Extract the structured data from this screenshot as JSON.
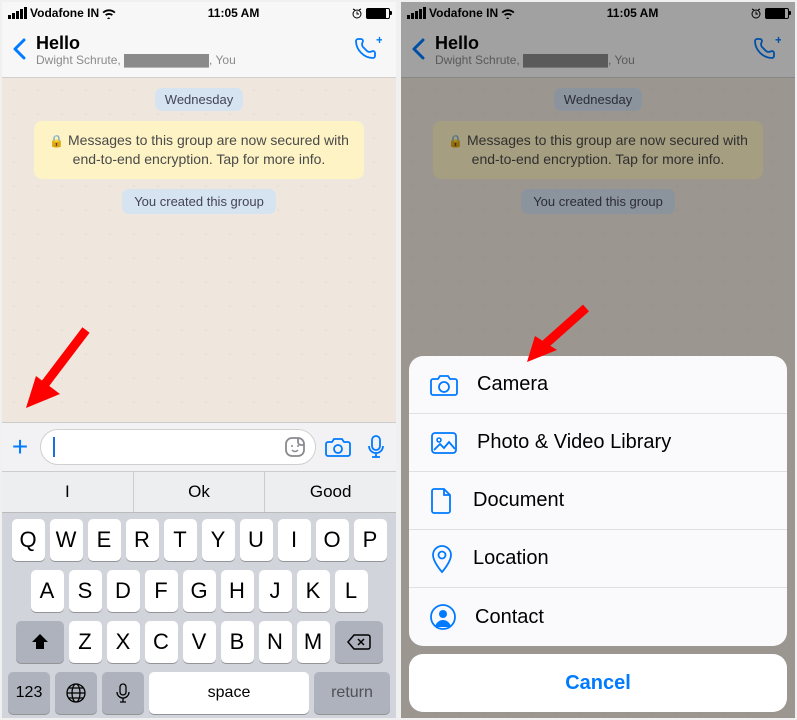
{
  "status": {
    "carrier": "Vodafone IN",
    "time": "11:05 AM"
  },
  "chat": {
    "title": "Hello",
    "subtitle": "Dwight Schrute, ██████████, You",
    "date_label": "Wednesday",
    "encryption_notice": "Messages to this group are now secured with end-to-end encryption. Tap for more info.",
    "system_message": "You created this group"
  },
  "suggestions": [
    "I",
    "Ok",
    "Good"
  ],
  "keyboard": {
    "row1": [
      "Q",
      "W",
      "E",
      "R",
      "T",
      "Y",
      "U",
      "I",
      "O",
      "P"
    ],
    "row2": [
      "A",
      "S",
      "D",
      "F",
      "G",
      "H",
      "J",
      "K",
      "L"
    ],
    "row3": [
      "Z",
      "X",
      "C",
      "V",
      "B",
      "N",
      "M"
    ],
    "numbers_label": "123",
    "space_label": "space",
    "return_label": "return"
  },
  "attachment_menu": {
    "camera": "Camera",
    "photo_video": "Photo & Video Library",
    "document": "Document",
    "location": "Location",
    "contact": "Contact",
    "cancel": "Cancel"
  }
}
